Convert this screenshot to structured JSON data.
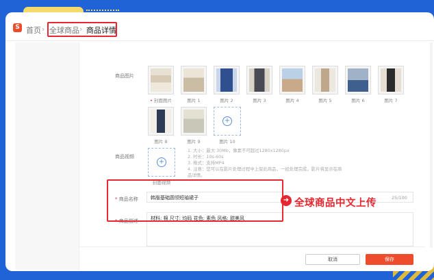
{
  "breadcrumb": {
    "logo": "S",
    "home": "首页",
    "sep": "›",
    "section": "全球商品",
    "current": "商品详情"
  },
  "images": {
    "label": "商品图片",
    "cover_caption": "封面图片",
    "cover_marker": "•",
    "captions": [
      "图片 1",
      "图片 2",
      "图片 3",
      "图片 4",
      "图片 5",
      "图片 6",
      "图片 7",
      "图片 8",
      "图片 9",
      "图片 10"
    ],
    "add_symbol": "+"
  },
  "video": {
    "label": "商品视频",
    "cover_caption": "封面视频",
    "hints": [
      "1. 大小：最大 30Mb，像素不可超过1280x1280px",
      "2. 时长：10s-60s",
      "3. 格式：支持MP4",
      "4. 注意：您可以在影片处理过程中上架此商品，一经处理完成，影片将显示在商",
      "品详情。"
    ]
  },
  "name_field": {
    "required": "*",
    "label": "商品名称",
    "value": "韩版基础圆领短袖裙子",
    "counter": "25/100"
  },
  "desc_field": {
    "required": "*",
    "label": "商品描述",
    "value": "材料: 棉  尺寸: 均码  花色: 素色 风格: 甜美风"
  },
  "callout": {
    "arrow": "➜",
    "text": "全球商品中文上传"
  },
  "buttons": {
    "cancel": "取消",
    "save": "保存"
  },
  "colors": {
    "brand": "#ee4d2d",
    "highlight": "#e8262f",
    "background": "#1f63d6"
  }
}
